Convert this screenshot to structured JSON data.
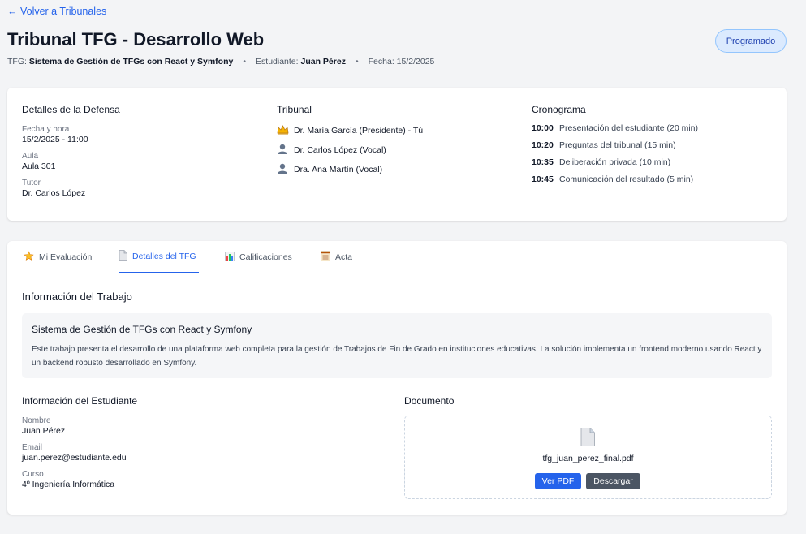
{
  "header": {
    "back_label": "← Volver a Tribunales",
    "title": "Tribunal TFG - Desarrollo Web",
    "status": "Programado",
    "tfg_label": "TFG:",
    "tfg_value": "Sistema de Gestión de TFGs con React y Symfony",
    "student_label": "Estudiante:",
    "student_value": "Juan Pérez",
    "date_label": "Fecha:",
    "date_value": "15/2/2025",
    "separator": "•"
  },
  "defense": {
    "title": "Detalles de la Defensa",
    "fields": [
      {
        "label": "Fecha y hora",
        "value": "15/2/2025 - 11:00"
      },
      {
        "label": "Aula",
        "value": "Aula 301"
      },
      {
        "label": "Tutor",
        "value": "Dr. Carlos López"
      }
    ]
  },
  "tribunal": {
    "title": "Tribunal",
    "members": [
      {
        "icon": "crown-icon",
        "text": "Dr. María García (Presidente) - Tú"
      },
      {
        "icon": "user-icon",
        "text": "Dr. Carlos López (Vocal)"
      },
      {
        "icon": "user-icon",
        "text": "Dra. Ana Martín (Vocal)"
      }
    ]
  },
  "schedule": {
    "title": "Cronograma",
    "items": [
      {
        "time": "10:00",
        "text": "Presentación del estudiante (20 min)"
      },
      {
        "time": "10:20",
        "text": "Preguntas del tribunal (15 min)"
      },
      {
        "time": "10:35",
        "text": "Deliberación privada (10 min)"
      },
      {
        "time": "10:45",
        "text": "Comunicación del resultado (5 min)"
      }
    ]
  },
  "tabs": [
    {
      "icon": "star-icon",
      "label": "Mi Evaluación",
      "active": false
    },
    {
      "icon": "document-icon",
      "label": "Detalles del TFG",
      "active": true
    },
    {
      "icon": "bar-chart-icon",
      "label": "Calificaciones",
      "active": false
    },
    {
      "icon": "notepad-icon",
      "label": "Acta",
      "active": false
    }
  ],
  "work": {
    "section_title": "Información del Trabajo",
    "title": "Sistema de Gestión de TFGs con React y Symfony",
    "description": "Este trabajo presenta el desarrollo de una plataforma web completa para la gestión de Trabajos de Fin de Grado en instituciones educativas. La solución implementa un frontend moderno usando React y un backend robusto desarrollado en Symfony."
  },
  "student": {
    "title": "Información del Estudiante",
    "fields": [
      {
        "label": "Nombre",
        "value": "Juan Pérez"
      },
      {
        "label": "Email",
        "value": "juan.perez@estudiante.edu"
      },
      {
        "label": "Curso",
        "value": "4º Ingeniería Informática"
      }
    ]
  },
  "document": {
    "title": "Documento",
    "icon": "file-icon",
    "filename": "tfg_juan_perez_final.pdf",
    "view_label": "Ver PDF",
    "download_label": "Descargar"
  },
  "colors": {
    "accent": "#2563eb",
    "badge_bg": "#dbeafe",
    "badge_text": "#1e40af",
    "secondary_button": "#4b5563"
  }
}
